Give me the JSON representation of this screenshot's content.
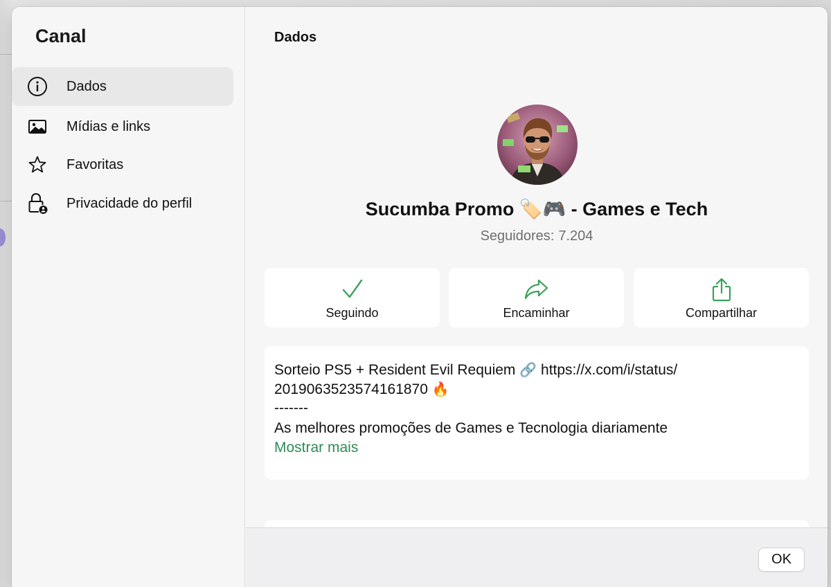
{
  "sidebar": {
    "title": "Canal",
    "items": [
      {
        "label": "Dados",
        "icon": "info-icon",
        "active": true
      },
      {
        "label": "Mídias e links",
        "icon": "image-icon",
        "active": false
      },
      {
        "label": "Favoritas",
        "icon": "star-icon",
        "active": false
      },
      {
        "label": "Privacidade do perfil",
        "icon": "lock-person-icon",
        "active": false
      }
    ]
  },
  "main": {
    "title": "Dados",
    "channel": {
      "name": "Sucumba Promo",
      "name_emoji": "🏷️🎮",
      "name_suffix": " - Games e Tech",
      "followers_label": "Seguidores:",
      "followers_count": "7.204"
    },
    "actions": [
      {
        "label": "Seguindo",
        "icon": "check-icon"
      },
      {
        "label": "Encaminhar",
        "icon": "forward-arrow-icon"
      },
      {
        "label": "Compartilhar",
        "icon": "share-icon"
      }
    ],
    "description": {
      "line1_text": "Sorteio PS5 + Resident Evil Requiem",
      "line1_emoji": "🔗",
      "line1_url": "https://x.com/i/status/",
      "line2_text": "2019063523574161870",
      "line2_emoji": "🔥",
      "line3": "-------",
      "line4": "As melhores promoções de Games e Tecnologia diariamente",
      "show_more": "Mostrar mais"
    }
  },
  "footer": {
    "ok_label": "OK"
  },
  "colors": {
    "accent_green": "#2e8b57",
    "icon_green": "#3aa05a",
    "background": "#f6f6f6",
    "card": "#ffffff"
  }
}
